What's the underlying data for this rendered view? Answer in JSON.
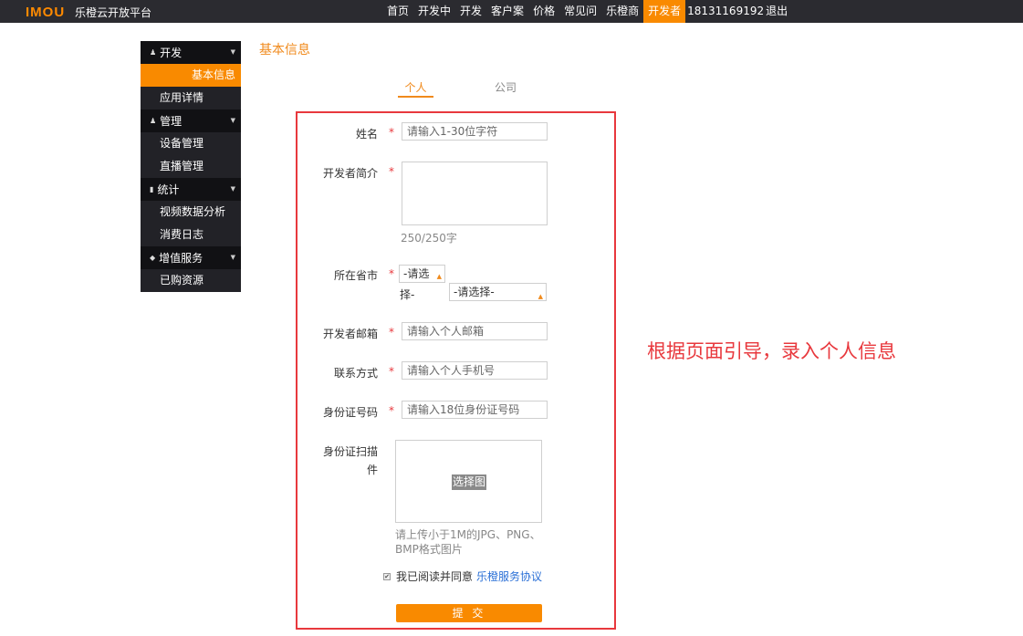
{
  "header": {
    "logo": "IMOU",
    "site_name": "乐橙云开放平台",
    "nav": [
      "首页",
      "开发中",
      "开发",
      "客户案",
      "价格",
      "常见问",
      "乐橙商",
      "开发者"
    ],
    "active_nav": "开发者",
    "phone": "181311691",
    "phone_tail": "92",
    "logout": "退出"
  },
  "sidebar": {
    "groups": [
      {
        "label": "开发",
        "items": [
          "基本信息",
          "应用详情"
        ]
      },
      {
        "label": "管理",
        "items": [
          "设备管理",
          "直播管理"
        ]
      },
      {
        "label": "统计",
        "items": [
          "视频数据分析",
          "消费日志"
        ]
      },
      {
        "label": "增值服务",
        "items": [
          "已购资源"
        ]
      }
    ],
    "active_item": "基本信息"
  },
  "page_title": "基本信息",
  "tabs": {
    "personal": "个人",
    "company": "公司"
  },
  "form": {
    "name_label": "姓名",
    "name_placeholder": "请输入1-30位字符",
    "intro_label": "开发者简介",
    "intro_counter": "250/250字",
    "region_label": "所在省市",
    "province_value": "-请选",
    "province_tail": "择-",
    "city_value": "-请选择-",
    "email_label": "开发者邮箱",
    "email_placeholder": "请输入个人邮箱",
    "phone_label": "联系方式",
    "phone_placeholder": "请输入个人手机号",
    "id_label": "身份证号码",
    "id_placeholder": "请输入18位身份证号码",
    "scan_label_1": "身份证扫描",
    "scan_label_2": "件",
    "upload_button": "选择图",
    "upload_hint": "请上传小于1M的JPG、PNG、BMP格式图片",
    "required_mark": "*",
    "agree_text": "我已阅读并同意",
    "agree_link": "乐橙服务协议",
    "submit": "提 交"
  },
  "annotation": "根据页面引导，录入个人信息",
  "colors": {
    "accent": "#f98a00",
    "topbar": "#2b2b30",
    "highlight": "#e8383d"
  }
}
